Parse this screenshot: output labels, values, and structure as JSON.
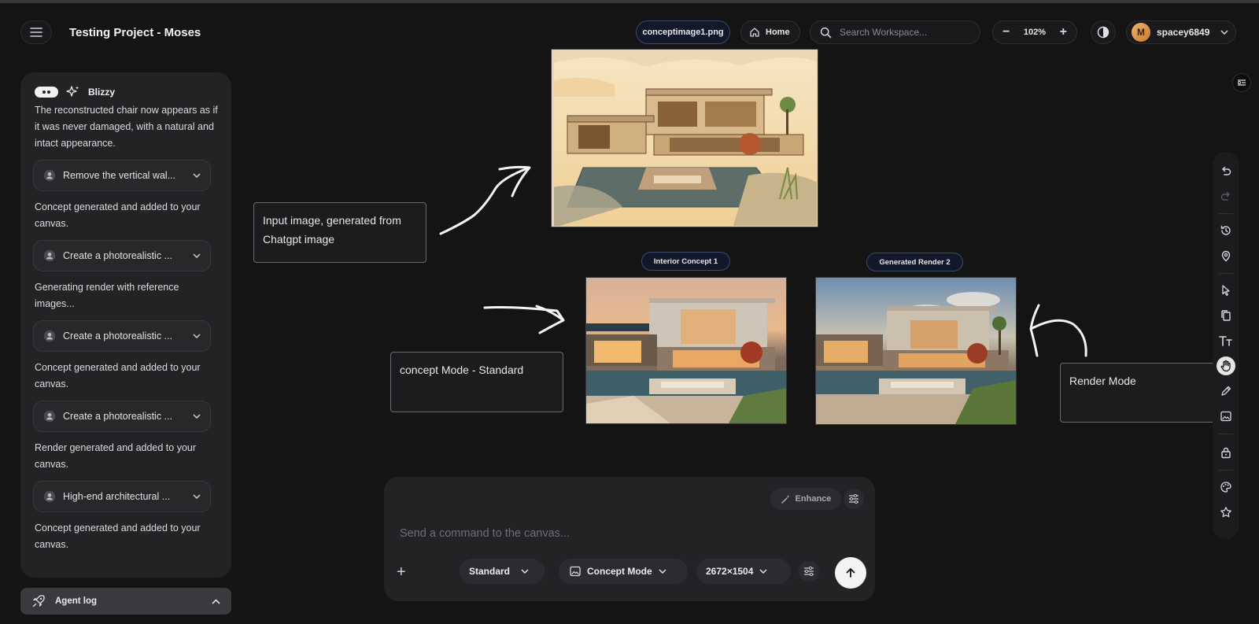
{
  "header": {
    "project_title": "Testing Project - Moses",
    "file_name": "conceptimage1.png",
    "home_label": "Home",
    "search_placeholder": "Search Workspace...",
    "zoom_level": "102%",
    "username": "spacey6849",
    "avatar_initial": "M"
  },
  "chat": {
    "assistant_name": "Blizzy",
    "intro_text": "The reconstructed chair now appears as if it was never damaged, with a natural and intact appearance.",
    "items": [
      {
        "command": "Remove the vertical wal...",
        "response": "Concept generated and added to your canvas."
      },
      {
        "command": "Create a photorealistic ...",
        "response": "Generating render with reference images..."
      },
      {
        "command": "Create a photorealistic ...",
        "response": "Concept generated and added to your canvas."
      },
      {
        "command": "Create a photorealistic ...",
        "response": "Render generated and added to your canvas."
      },
      {
        "command": "High-end architectural ...",
        "response": "Concept generated and added to your canvas."
      }
    ],
    "agent_log_label": "Agent log"
  },
  "canvas": {
    "notes": {
      "input_image": "Input image, generated from Chatgpt image",
      "concept_mode": "concept Mode - Standard",
      "render_mode": "Render Mode"
    },
    "tags": {
      "interior_concept": "Interior Concept 1",
      "generated_render": "Generated Render 2"
    }
  },
  "prompt": {
    "enhance_label": "Enhance",
    "placeholder": "Send a command to the canvas...",
    "quality": "Standard",
    "mode": "Concept Mode",
    "resolution": "2672×1504"
  },
  "toolbar": {
    "tools": [
      "undo-icon",
      "redo-icon",
      "history-icon",
      "location-icon",
      "pointer-icon",
      "copy-icon",
      "text-icon",
      "hand-icon",
      "edit-icon",
      "image-icon",
      "lock-icon",
      "palette-icon",
      "star-icon"
    ],
    "active_tool": "hand-icon"
  },
  "colors": {
    "background": "#141415",
    "panel": "#232326",
    "tag_border": "#3b4a6b"
  }
}
